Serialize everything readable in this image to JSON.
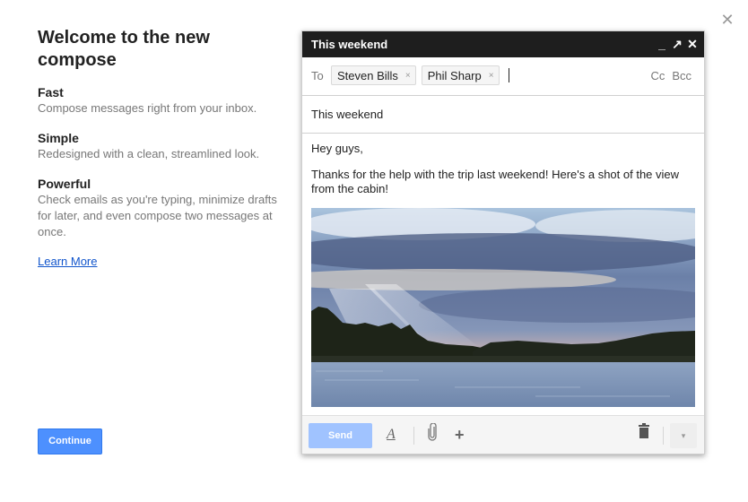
{
  "dialog": {
    "close_icon": "close-icon"
  },
  "intro": {
    "title": "Welcome to the new compose",
    "features": [
      {
        "title": "Fast",
        "description": "Compose messages right from your inbox."
      },
      {
        "title": "Simple",
        "description": "Redesigned with a clean, streamlined look."
      },
      {
        "title": "Powerful",
        "description": "Check emails as you're typing, minimize drafts for later, and even compose two messages at once."
      }
    ],
    "learn_more": "Learn More",
    "continue_label": "Continue"
  },
  "compose": {
    "window_title": "This weekend",
    "header_icons": {
      "minimize": "_",
      "popout": "↗",
      "close": "✕"
    },
    "to_label": "To",
    "recipients": [
      {
        "name": "Steven Bills",
        "remove": "×"
      },
      {
        "name": "Phil Sharp",
        "remove": "×"
      }
    ],
    "cc_label": "Cc",
    "bcc_label": "Bcc",
    "subject": "This weekend",
    "body": {
      "greeting": "Hey guys,",
      "message": "Thanks for the help with the trip last weekend!  Here's a shot of the view from the cabin!"
    },
    "footer": {
      "send_label": "Send",
      "formatting_glyph": "A",
      "attach_glyph": "📎",
      "insert_glyph": "+",
      "discard_glyph": "🗑",
      "more_glyph": "▾"
    }
  },
  "colors": {
    "header_bg": "#1e1e1e",
    "continue_blue": "#4d90fe",
    "send_disabled_blue": "#a0c3ff",
    "link_blue": "#1155cc"
  }
}
